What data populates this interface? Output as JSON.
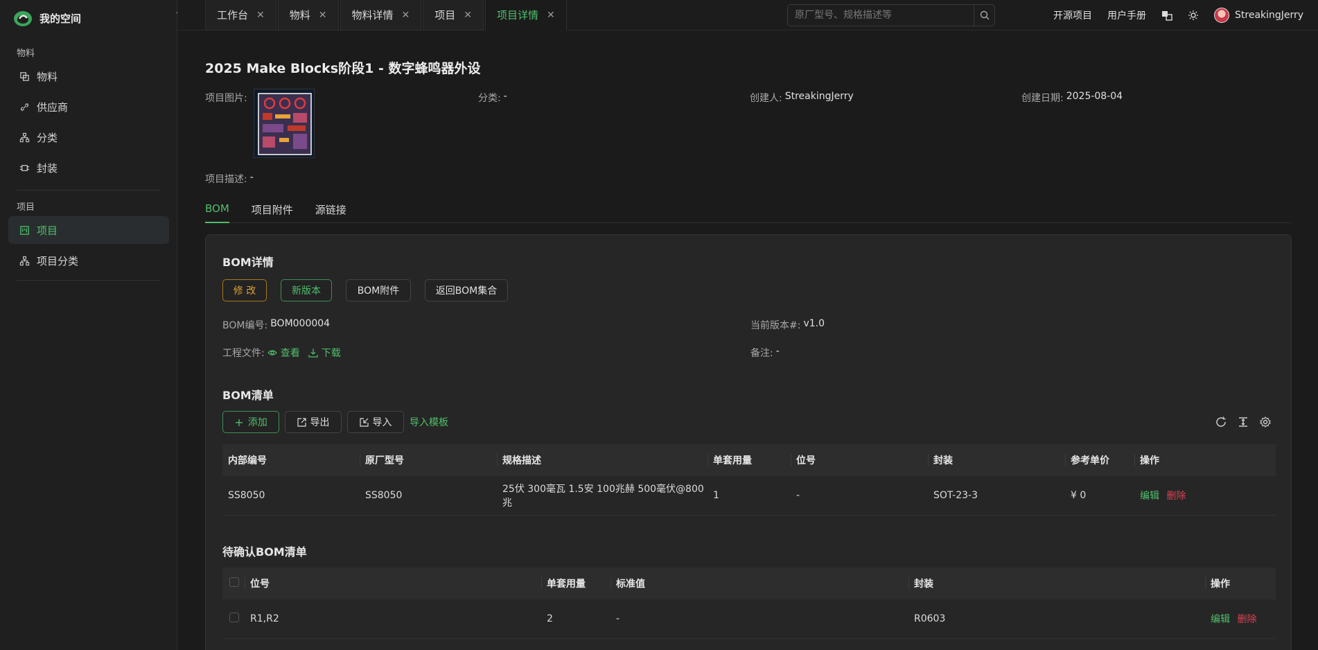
{
  "brand": {
    "name": "我的空间"
  },
  "sidebar": {
    "groups": [
      {
        "title": "物料",
        "items": [
          {
            "label": "物料"
          },
          {
            "label": "供应商"
          },
          {
            "label": "分类"
          },
          {
            "label": "封装"
          }
        ]
      },
      {
        "title": "项目",
        "items": [
          {
            "label": "项目"
          },
          {
            "label": "项目分类"
          }
        ]
      }
    ]
  },
  "tabs": [
    {
      "label": "工作台"
    },
    {
      "label": "物料"
    },
    {
      "label": "物料详情"
    },
    {
      "label": "项目"
    },
    {
      "label": "项目详情"
    }
  ],
  "search": {
    "placeholder": "原厂型号、规格描述等"
  },
  "top_links": {
    "open_source": "开源项目",
    "manual": "用户手册",
    "username": "StreakingJerry"
  },
  "project": {
    "title": "2025 Make Blocks阶段1 - 数字蜂鸣器外设",
    "image_label": "项目图片:",
    "category_label": "分类:",
    "category": "-",
    "creator_label": "创建人:",
    "creator": "StreakingJerry",
    "date_label": "创建日期:",
    "date": "2025-08-04",
    "desc_label": "项目描述:",
    "desc": "-"
  },
  "subtabs": [
    {
      "label": "BOM"
    },
    {
      "label": "项目附件"
    },
    {
      "label": "源链接"
    }
  ],
  "bom": {
    "title": "BOM详情",
    "buttons": {
      "edit": "修 改",
      "new_version": "新版本",
      "attachments": "BOM附件",
      "back": "返回BOM集合"
    },
    "code_label": "BOM编号:",
    "code": "BOM000004",
    "version_label": "当前版本#:",
    "version": "v1.0",
    "file_label": "工程文件:",
    "view": "查看",
    "download": "下载",
    "note_label": "备注:",
    "note": "-"
  },
  "bom_list": {
    "title": "BOM清单",
    "buttons": {
      "add": "添加",
      "export": "导出",
      "import": "导入",
      "template": "导入模板"
    },
    "columns": [
      "内部编号",
      "原厂型号",
      "规格描述",
      "单套用量",
      "位号",
      "封装",
      "参考单价",
      "操作"
    ],
    "rows": [
      {
        "code": "SS8050",
        "model": "SS8050",
        "spec": "25伏 300毫瓦 1.5安 100兆赫 500毫伏@800兆",
        "qty": "1",
        "ref": "-",
        "package": "SOT-23-3",
        "price": "¥ 0",
        "edit": "编辑",
        "delete": "删除"
      }
    ]
  },
  "pending": {
    "title": "待确认BOM清单",
    "columns": [
      "位号",
      "单套用量",
      "标准值",
      "封装",
      "操作"
    ],
    "rows": [
      {
        "ref": "R1,R2",
        "qty": "2",
        "value": "-",
        "package": "R0603",
        "edit": "编辑",
        "delete": "删除"
      }
    ]
  },
  "colors": {
    "accent": "#4fbf6b",
    "danger": "#d9434f",
    "warning": "#d9a23b",
    "background": "#1b1b1b"
  }
}
